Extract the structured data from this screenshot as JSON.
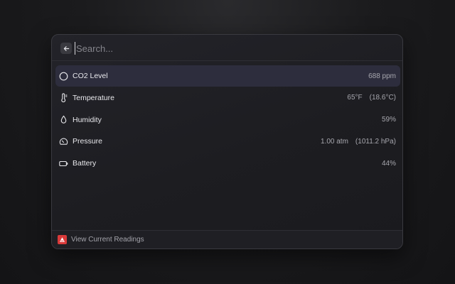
{
  "search": {
    "placeholder": "Search..."
  },
  "items": [
    {
      "icon": "circle-icon",
      "label": "CO2 Level",
      "value": "688 ppm",
      "value2": ""
    },
    {
      "icon": "thermometer-icon",
      "label": "Temperature",
      "value": "65°F",
      "value2": "(18.6°C)"
    },
    {
      "icon": "droplet-icon",
      "label": "Humidity",
      "value": "59%",
      "value2": ""
    },
    {
      "icon": "gauge-icon",
      "label": "Pressure",
      "value": "1.00 atm",
      "value2": "(1011.2 hPa)"
    },
    {
      "icon": "battery-icon",
      "label": "Battery",
      "value": "44%",
      "value2": ""
    }
  ],
  "footer": {
    "label": "View Current Readings",
    "icon": "aranet-logo-icon"
  },
  "colors": {
    "selected_row": "#2d2d3d",
    "footer_icon": "#d93a3a",
    "text": "#e8e8ec",
    "muted": "#a7a7ae"
  }
}
